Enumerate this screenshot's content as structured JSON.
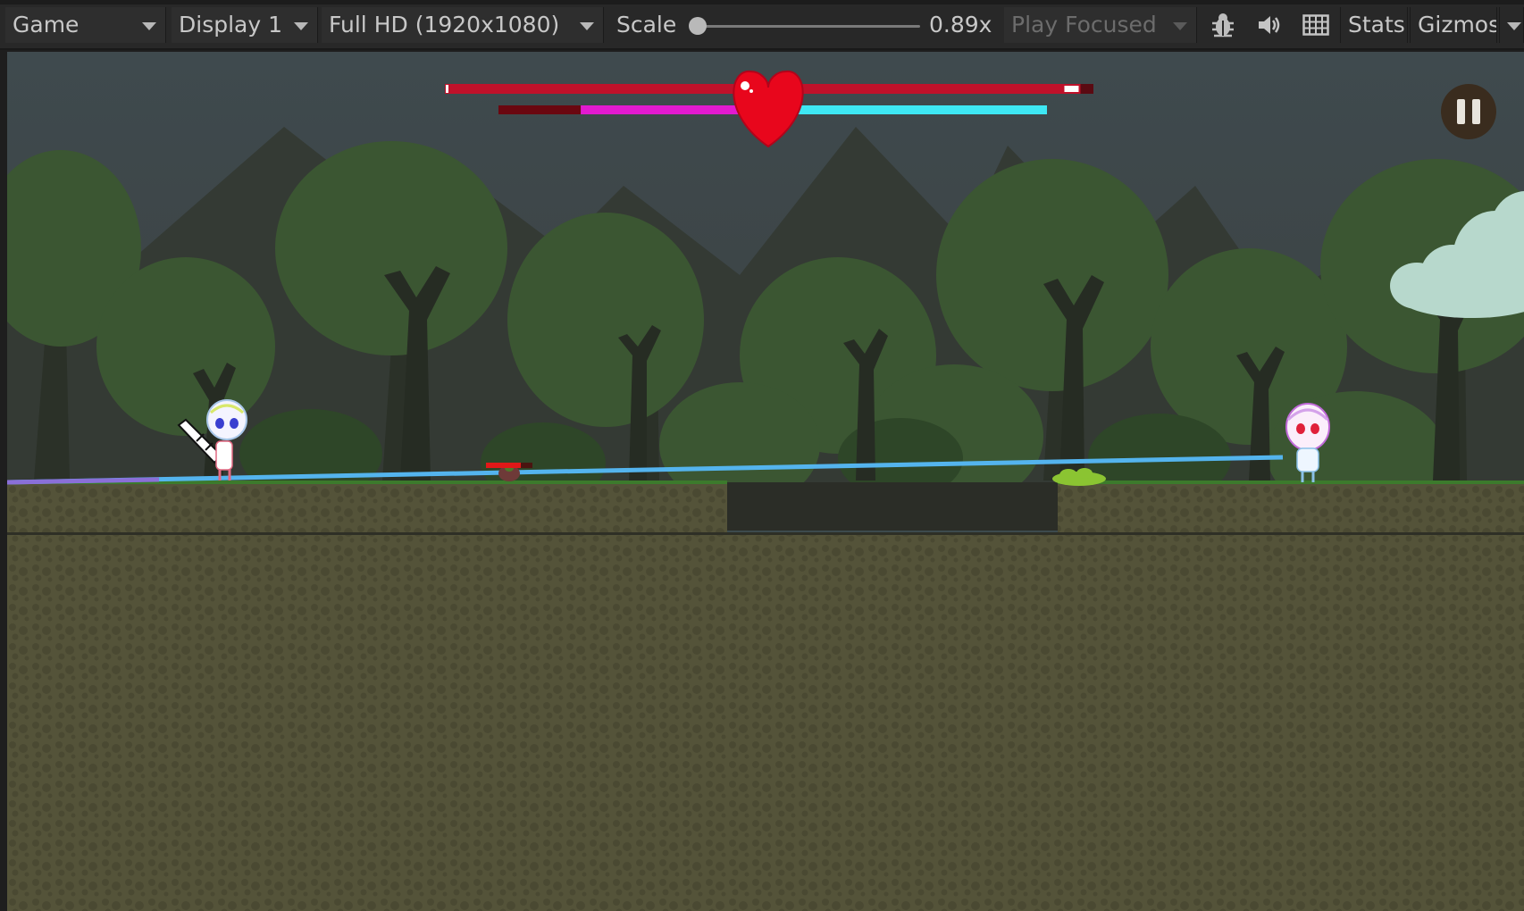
{
  "toolbar": {
    "view_dropdown": "Game",
    "display_dropdown": "Display 1",
    "resolution_dropdown": "Full HD (1920x1080)",
    "scale_label": "Scale",
    "scale_value": "0.89x",
    "scale_level": 0.0,
    "play_mode_dropdown": "Play Focused",
    "stats_button": "Stats",
    "gizmos_button": "Gizmos",
    "icons": [
      "bug-icon",
      "speaker-icon",
      "grid-icon"
    ]
  },
  "hud": {
    "player_health_fraction": 0.98,
    "balance_bar": {
      "dark_red_fraction": 0.15,
      "magenta_fraction": 0.31,
      "cyan_fraction": 0.54
    },
    "heart_icon": "heart-icon",
    "pause_icon": "pause-icon",
    "enemy_health_fraction": 0.75
  },
  "colors": {
    "health_red": "#c0112a",
    "magenta": "#e21ad0",
    "cyan": "#3ee8f4",
    "dark_red": "#6a0710",
    "heart": "#e8061c",
    "laser": "#54b4ee",
    "grass": "#3c7a2c"
  }
}
